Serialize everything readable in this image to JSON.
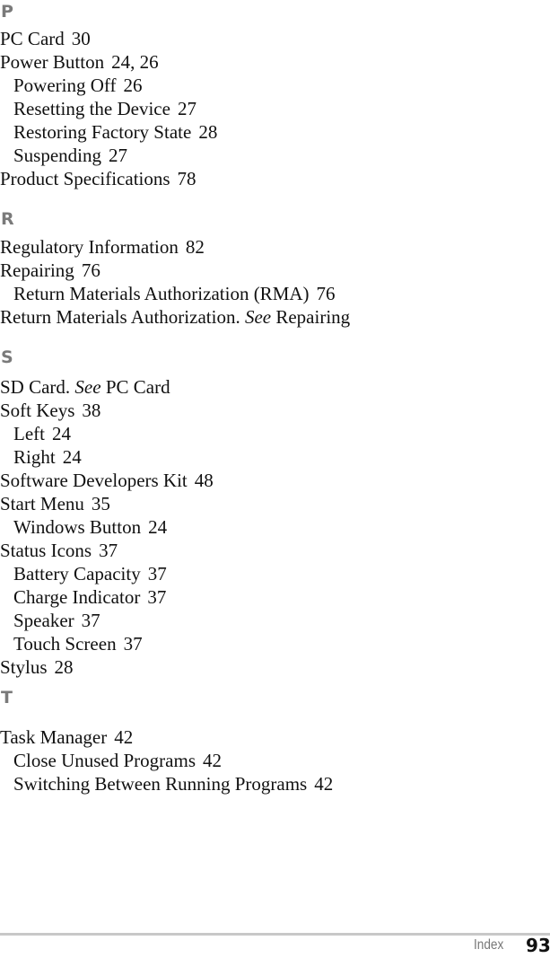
{
  "sections": [
    {
      "letter": "P",
      "entries": [
        {
          "level": 1,
          "term": "PC Card",
          "pages": "30"
        },
        {
          "level": 1,
          "term": "Power Button",
          "pages": "24, 26"
        },
        {
          "level": 2,
          "term": "Powering Off",
          "pages": "26"
        },
        {
          "level": 2,
          "term": "Resetting the Device",
          "pages": "27"
        },
        {
          "level": 2,
          "term": "Restoring Factory State",
          "pages": "28"
        },
        {
          "level": 2,
          "term": "Suspending",
          "pages": "27"
        },
        {
          "level": 1,
          "term": "Product Specifications",
          "pages": "78"
        }
      ]
    },
    {
      "letter": "R",
      "entries": [
        {
          "level": 1,
          "term": "Regulatory Information",
          "pages": "82"
        },
        {
          "level": 1,
          "term": "Repairing",
          "pages": "76"
        },
        {
          "level": 2,
          "term": "Return Materials Authorization (RMA)",
          "pages": "76"
        },
        {
          "level": 1,
          "term": "Return Materials Authorization.",
          "see_label": "See",
          "see_target": "Repairing"
        }
      ]
    },
    {
      "letter": "S",
      "entries": [
        {
          "level": 1,
          "term": "SD Card.",
          "see_label": "See",
          "see_target": "PC Card"
        },
        {
          "level": 1,
          "term": "Soft Keys",
          "pages": "38"
        },
        {
          "level": 2,
          "term": "Left",
          "pages": "24"
        },
        {
          "level": 2,
          "term": "Right",
          "pages": "24"
        },
        {
          "level": 1,
          "term": "Software Developers Kit",
          "pages": "48"
        },
        {
          "level": 1,
          "term": "Start Menu",
          "pages": "35"
        },
        {
          "level": 2,
          "term": "Windows Button",
          "pages": "24"
        },
        {
          "level": 1,
          "term": "Status Icons",
          "pages": "37"
        },
        {
          "level": 2,
          "term": "Battery Capacity",
          "pages": "37"
        },
        {
          "level": 2,
          "term": "Charge Indicator",
          "pages": "37"
        },
        {
          "level": 2,
          "term": "Speaker",
          "pages": "37"
        },
        {
          "level": 2,
          "term": "Touch Screen",
          "pages": "37"
        },
        {
          "level": 1,
          "term": "Stylus",
          "pages": "28"
        }
      ]
    },
    {
      "letter": "T",
      "entries": [
        {
          "level": 1,
          "term": "Task Manager",
          "pages": "42"
        },
        {
          "level": 2,
          "term": "Close Unused Programs",
          "pages": "42"
        },
        {
          "level": 2,
          "term": "Switching Between Running Programs",
          "pages": "42"
        }
      ]
    }
  ],
  "footer": {
    "section_label": "Index",
    "page_number": "93"
  }
}
